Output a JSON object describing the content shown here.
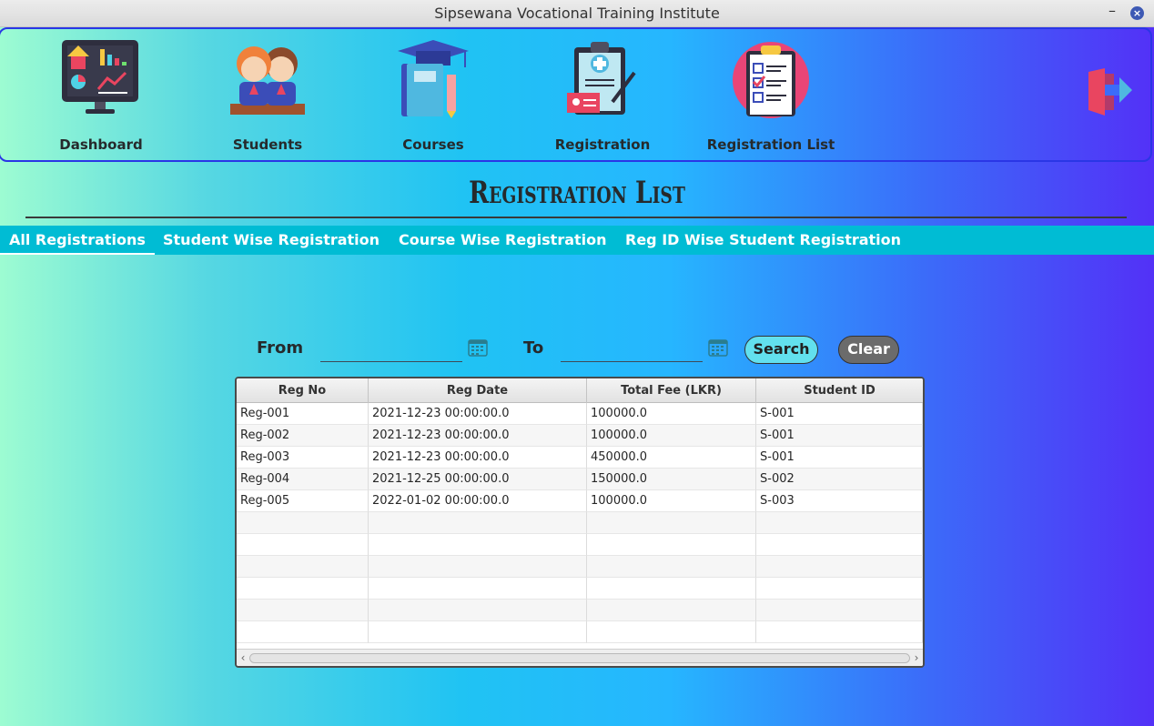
{
  "window": {
    "title": "Sipsewana Vocational Training Institute",
    "minimize_glyph": "–",
    "close_glyph": "×"
  },
  "nav": {
    "items": [
      {
        "label": "Dashboard",
        "icon": "dashboard-monitor-icon"
      },
      {
        "label": "Students",
        "icon": "students-icon"
      },
      {
        "label": "Courses",
        "icon": "courses-book-icon"
      },
      {
        "label": "Registration",
        "icon": "registration-clipboard-icon"
      },
      {
        "label": "Registration List",
        "icon": "registration-list-icon"
      }
    ],
    "logout_icon": "logout-door-icon"
  },
  "page": {
    "heading": "Registration List"
  },
  "tabs": [
    {
      "label": "All Registrations",
      "active": true
    },
    {
      "label": "Student Wise Registration",
      "active": false
    },
    {
      "label": "Course Wise Registration",
      "active": false
    },
    {
      "label": "Reg ID Wise Student Registration",
      "active": false
    }
  ],
  "filter": {
    "from_label": "From",
    "from_value": "",
    "to_label": "To",
    "to_value": "",
    "calendar_icon": "calendar-icon",
    "search_label": "Search",
    "clear_label": "Clear"
  },
  "table": {
    "columns": [
      "Reg No",
      "Reg Date",
      "Total Fee (LKR)",
      "Student ID"
    ],
    "rows": [
      [
        "Reg-001",
        "2021-12-23 00:00:00.0",
        "100000.0",
        "S-001"
      ],
      [
        "Reg-002",
        "2021-12-23 00:00:00.0",
        "100000.0",
        "S-001"
      ],
      [
        "Reg-003",
        "2021-12-23 00:00:00.0",
        "450000.0",
        "S-001"
      ],
      [
        "Reg-004",
        "2021-12-25 00:00:00.0",
        "150000.0",
        "S-002"
      ],
      [
        "Reg-005",
        "2022-01-02 00:00:00.0",
        "100000.0",
        "S-003"
      ]
    ],
    "scroll_left": "‹",
    "scroll_right": "›"
  },
  "colors": {
    "tab_bar": "#00bcd4",
    "search_button": "#62e0ee",
    "clear_button": "#6b6b6b",
    "nav_border": "#2a36e6"
  }
}
